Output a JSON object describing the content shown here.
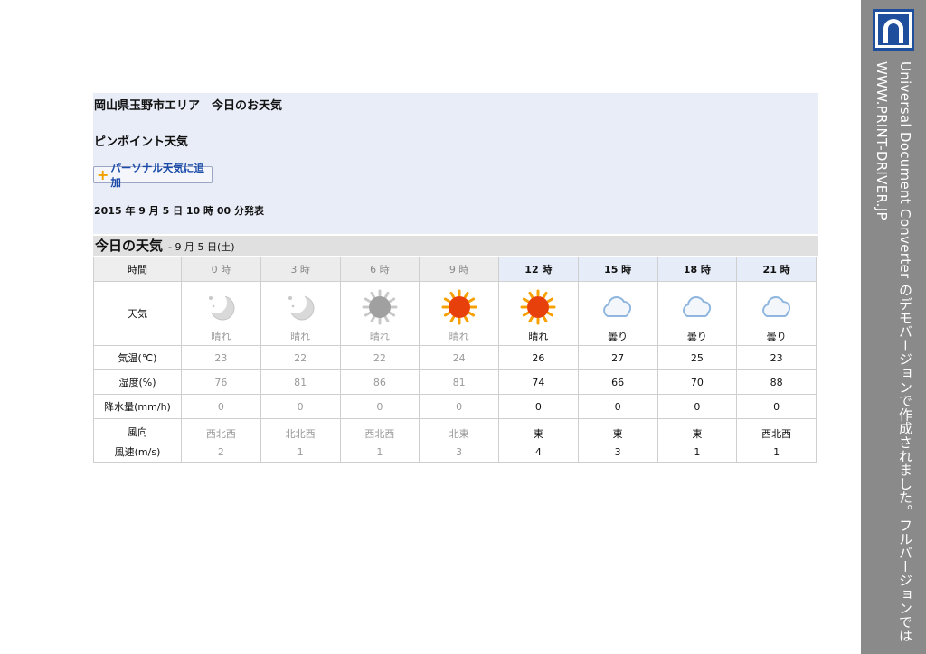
{
  "header": {
    "title": "岡山県玉野市エリア　今日のお天気",
    "subtitle": "ピンポイント天気",
    "add_button": "パーソナル天気に追加",
    "published": "2015 年 9 月 5 日  10 時 00 分発表"
  },
  "today": {
    "title": "今日の天気",
    "date": "- 9 月 5 日(土)"
  },
  "table": {
    "row_labels": {
      "time": "時間",
      "weather": "天気",
      "temp": "気温(℃)",
      "humidity": "湿度(%)",
      "precip": "降水量(mm/h)",
      "wind_dir": "風向",
      "wind_speed": "風速(m/s)"
    },
    "hours": [
      {
        "time": "0 時",
        "past": true,
        "icon": "moon-icon",
        "weather": "晴れ",
        "temp": "23",
        "humidity": "76",
        "precip": "0",
        "wind_dir": "西北西",
        "wind_speed": "2"
      },
      {
        "time": "3 時",
        "past": true,
        "icon": "moon-icon",
        "weather": "晴れ",
        "temp": "22",
        "humidity": "81",
        "precip": "0",
        "wind_dir": "北北西",
        "wind_speed": "1"
      },
      {
        "time": "6 時",
        "past": true,
        "icon": "sun-grey-icon",
        "weather": "晴れ",
        "temp": "22",
        "humidity": "86",
        "precip": "0",
        "wind_dir": "西北西",
        "wind_speed": "1"
      },
      {
        "time": "9 時",
        "past": true,
        "icon": "sun-icon",
        "weather": "晴れ",
        "temp": "24",
        "humidity": "81",
        "precip": "0",
        "wind_dir": "北東",
        "wind_speed": "3"
      },
      {
        "time": "12 時",
        "past": false,
        "icon": "sun-icon",
        "weather": "晴れ",
        "temp": "26",
        "humidity": "74",
        "precip": "0",
        "wind_dir": "東",
        "wind_speed": "4"
      },
      {
        "time": "15 時",
        "past": false,
        "icon": "cloud-icon",
        "weather": "曇り",
        "temp": "27",
        "humidity": "66",
        "precip": "0",
        "wind_dir": "東",
        "wind_speed": "3"
      },
      {
        "time": "18 時",
        "past": false,
        "icon": "cloud-icon",
        "weather": "曇り",
        "temp": "25",
        "humidity": "70",
        "precip": "0",
        "wind_dir": "東",
        "wind_speed": "1"
      },
      {
        "time": "21 時",
        "past": false,
        "icon": "cloud-icon",
        "weather": "曇り",
        "temp": "23",
        "humidity": "88",
        "precip": "0",
        "wind_dir": "西北西",
        "wind_speed": "1"
      }
    ]
  },
  "watermark": {
    "line1": "Universal Document Converter のデモバージョンで作成されました。フルバージョンでは",
    "line2": "WWW.PRINT-DRIVER.JP"
  },
  "colors": {
    "panel_bg": "#e9edf7",
    "sidebar_bg": "#8a8a8a",
    "sun": "#e8400a",
    "cloud": "#8fb6de"
  }
}
